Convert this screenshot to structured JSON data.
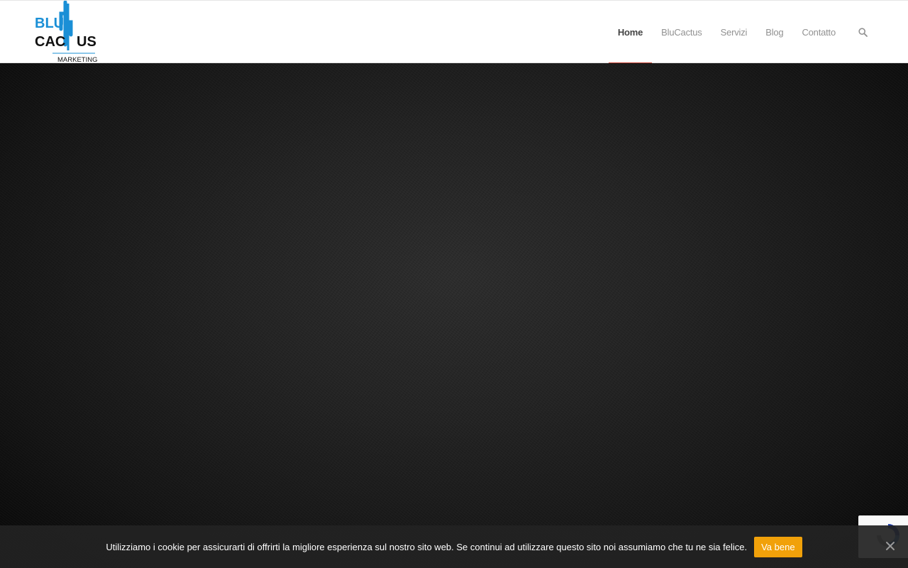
{
  "brand": {
    "logo_line1": "BLU",
    "logo_line2": "CAC",
    "logo_line2_end": "US",
    "logo_sub": "MARKETING",
    "accent": "#1a8fd6"
  },
  "nav": {
    "items": [
      {
        "label": "Home",
        "active": true
      },
      {
        "label": "BluCactus",
        "active": false
      },
      {
        "label": "Servizi",
        "active": false
      },
      {
        "label": "Blog",
        "active": false
      },
      {
        "label": "Contatto",
        "active": false
      }
    ],
    "search_icon": "search-icon",
    "active_color": "#c0392b"
  },
  "cookie": {
    "text": "Utilizziamo i cookie per assicurarti di offrirti la migliore esperienza sul nostro sito web. Se continui ad utilizzare questo sito noi assumiamo che tu ne sia felice.",
    "accept_label": "Va bene",
    "accept_color": "#f1a10a",
    "close_icon": "close-icon"
  },
  "recaptcha": {
    "icon": "recaptcha-icon"
  }
}
